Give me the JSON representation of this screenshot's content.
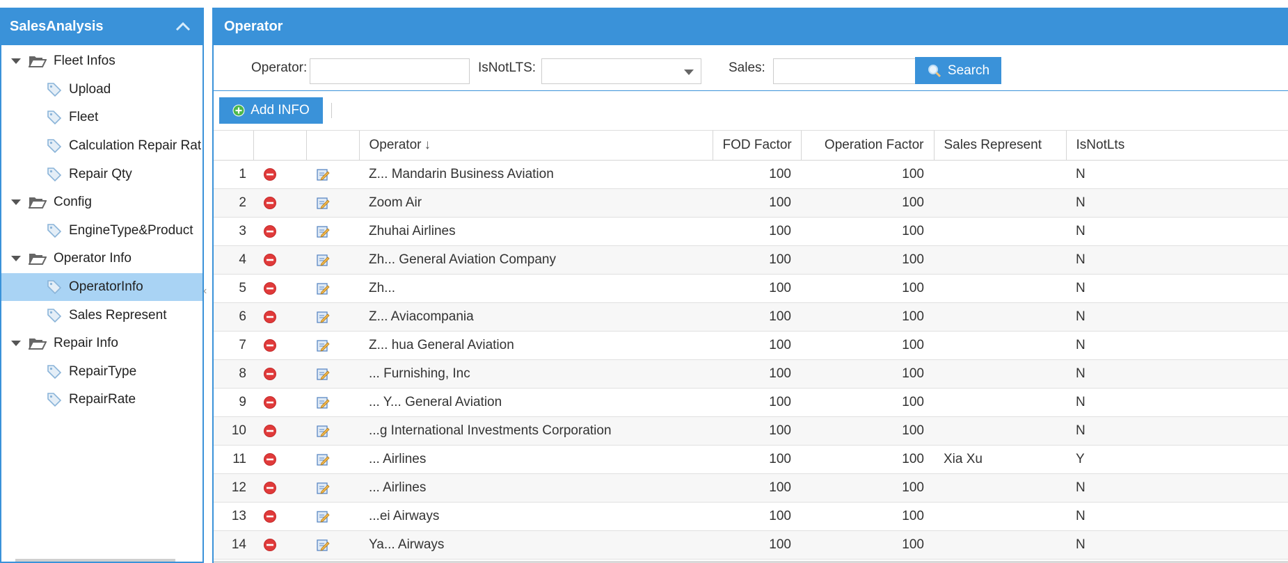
{
  "sidebar": {
    "title": "SalesAnalysis",
    "groups": [
      {
        "label": "Fleet Infos",
        "items": [
          "Upload",
          "Fleet",
          "Calculation Repair Rat",
          "Repair Qty"
        ]
      },
      {
        "label": "Config",
        "items": [
          "EngineType&Product"
        ]
      },
      {
        "label": "Operator Info",
        "items": [
          "OperatorInfo",
          "Sales Represent"
        ]
      },
      {
        "label": "Repair Info",
        "items": [
          "RepairType",
          "RepairRate"
        ]
      }
    ],
    "selected": "OperatorInfo"
  },
  "main": {
    "title": "Operator",
    "filters": {
      "operator_label": "Operator:",
      "isnotlts_label": "IsNotLTS:",
      "sales_label": "Sales:",
      "operator_value": "",
      "isnotlts_value": "",
      "sales_value": ""
    },
    "search_label": "Search",
    "add_label": "Add INFO",
    "table": {
      "columns": [
        "",
        "",
        "",
        "Operator",
        "FOD Factor",
        "Operation Factor",
        "Sales Represent",
        "IsNotLts"
      ],
      "sort_indicator": "↓",
      "rows": [
        {
          "idx": "1",
          "operator": "Z... Mandarin Business Aviation",
          "fod": "100",
          "op": "100",
          "sales": "",
          "lts": "N"
        },
        {
          "idx": "2",
          "operator": "Zoom Air",
          "fod": "100",
          "op": "100",
          "sales": "",
          "lts": "N"
        },
        {
          "idx": "3",
          "operator": "Zhuhai Airlines",
          "fod": "100",
          "op": "100",
          "sales": "",
          "lts": "N"
        },
        {
          "idx": "4",
          "operator": "Zh... General Aviation Company",
          "fod": "100",
          "op": "100",
          "sales": "",
          "lts": "N"
        },
        {
          "idx": "5",
          "operator": "Zh...",
          "fod": "100",
          "op": "100",
          "sales": "",
          "lts": "N"
        },
        {
          "idx": "6",
          "operator": "Z... Aviacompania",
          "fod": "100",
          "op": "100",
          "sales": "",
          "lts": "N"
        },
        {
          "idx": "7",
          "operator": "Z... hua General Aviation",
          "fod": "100",
          "op": "100",
          "sales": "",
          "lts": "N"
        },
        {
          "idx": "8",
          "operator": "... Furnishing, Inc",
          "fod": "100",
          "op": "100",
          "sales": "",
          "lts": "N"
        },
        {
          "idx": "9",
          "operator": "... Y... General Aviation",
          "fod": "100",
          "op": "100",
          "sales": "",
          "lts": "N"
        },
        {
          "idx": "10",
          "operator": "...g International Investments Corporation",
          "fod": "100",
          "op": "100",
          "sales": "",
          "lts": "N"
        },
        {
          "idx": "11",
          "operator": "... Airlines",
          "fod": "100",
          "op": "100",
          "sales": "Xia Xu",
          "lts": "Y"
        },
        {
          "idx": "12",
          "operator": "... Airlines",
          "fod": "100",
          "op": "100",
          "sales": "",
          "lts": "N"
        },
        {
          "idx": "13",
          "operator": "...ei Airways",
          "fod": "100",
          "op": "100",
          "sales": "",
          "lts": "N"
        },
        {
          "idx": "14",
          "operator": "Ya... Airways",
          "fod": "100",
          "op": "100",
          "sales": "",
          "lts": "N"
        }
      ]
    }
  },
  "colors": {
    "accent": "#3a92d9",
    "selected": "#a9d3f4",
    "delete": "#e03a3a"
  }
}
